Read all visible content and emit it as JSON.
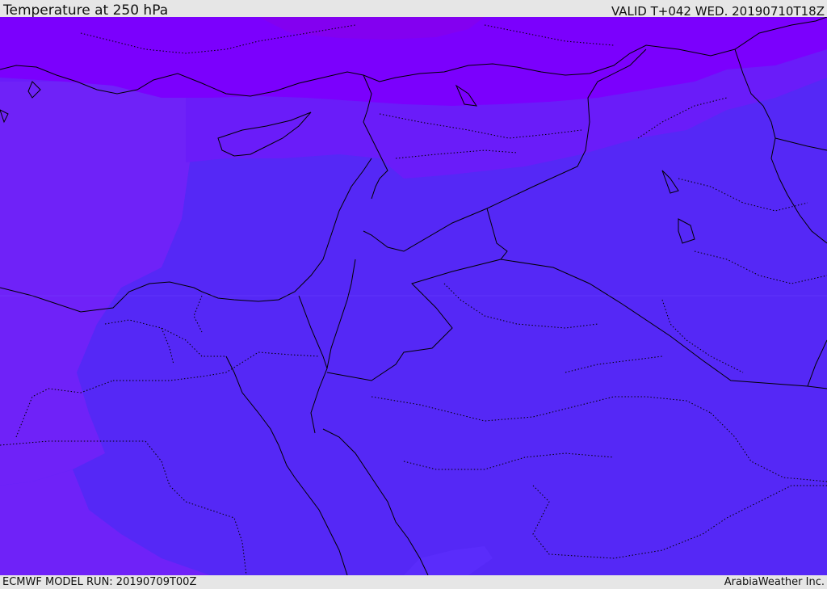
{
  "header": {
    "title": "Temperature at 250 hPa",
    "valid_time": "VALID T+042 WED. 20190710T18Z"
  },
  "footer": {
    "model_run": "ECMWF MODEL RUN: 20190709T00Z",
    "credit": "ArabiaWeather Inc."
  },
  "map": {
    "field_colors": {
      "coldest_band": "#7b00fd",
      "cold_band": "#6f18fb",
      "mid_band": "#5a2cfb",
      "base_band": "#5528f6",
      "west_purple": "#7a14f2"
    },
    "border_color": "#000000",
    "coastline_color": "#000000"
  }
}
